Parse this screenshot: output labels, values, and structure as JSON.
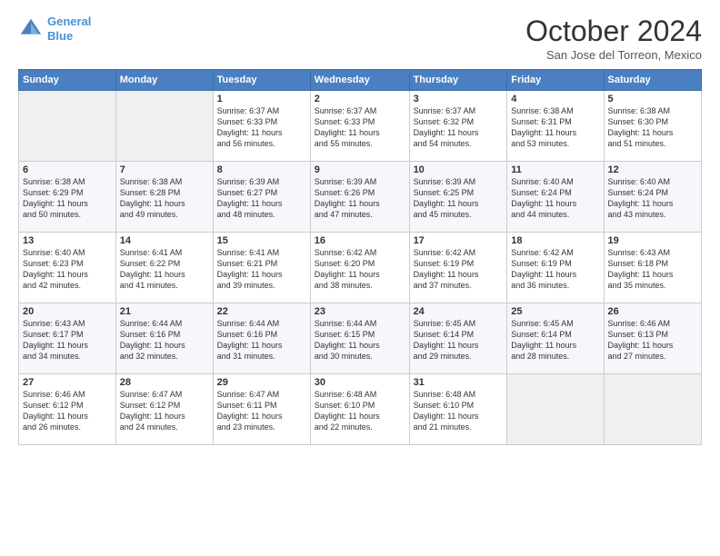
{
  "logo": {
    "line1": "General",
    "line2": "Blue"
  },
  "title": "October 2024",
  "location": "San Jose del Torreon, Mexico",
  "weekdays": [
    "Sunday",
    "Monday",
    "Tuesday",
    "Wednesday",
    "Thursday",
    "Friday",
    "Saturday"
  ],
  "weeks": [
    [
      {
        "day": "",
        "info": ""
      },
      {
        "day": "",
        "info": ""
      },
      {
        "day": "1",
        "info": "Sunrise: 6:37 AM\nSunset: 6:33 PM\nDaylight: 11 hours\nand 56 minutes."
      },
      {
        "day": "2",
        "info": "Sunrise: 6:37 AM\nSunset: 6:33 PM\nDaylight: 11 hours\nand 55 minutes."
      },
      {
        "day": "3",
        "info": "Sunrise: 6:37 AM\nSunset: 6:32 PM\nDaylight: 11 hours\nand 54 minutes."
      },
      {
        "day": "4",
        "info": "Sunrise: 6:38 AM\nSunset: 6:31 PM\nDaylight: 11 hours\nand 53 minutes."
      },
      {
        "day": "5",
        "info": "Sunrise: 6:38 AM\nSunset: 6:30 PM\nDaylight: 11 hours\nand 51 minutes."
      }
    ],
    [
      {
        "day": "6",
        "info": "Sunrise: 6:38 AM\nSunset: 6:29 PM\nDaylight: 11 hours\nand 50 minutes."
      },
      {
        "day": "7",
        "info": "Sunrise: 6:38 AM\nSunset: 6:28 PM\nDaylight: 11 hours\nand 49 minutes."
      },
      {
        "day": "8",
        "info": "Sunrise: 6:39 AM\nSunset: 6:27 PM\nDaylight: 11 hours\nand 48 minutes."
      },
      {
        "day": "9",
        "info": "Sunrise: 6:39 AM\nSunset: 6:26 PM\nDaylight: 11 hours\nand 47 minutes."
      },
      {
        "day": "10",
        "info": "Sunrise: 6:39 AM\nSunset: 6:25 PM\nDaylight: 11 hours\nand 45 minutes."
      },
      {
        "day": "11",
        "info": "Sunrise: 6:40 AM\nSunset: 6:24 PM\nDaylight: 11 hours\nand 44 minutes."
      },
      {
        "day": "12",
        "info": "Sunrise: 6:40 AM\nSunset: 6:24 PM\nDaylight: 11 hours\nand 43 minutes."
      }
    ],
    [
      {
        "day": "13",
        "info": "Sunrise: 6:40 AM\nSunset: 6:23 PM\nDaylight: 11 hours\nand 42 minutes."
      },
      {
        "day": "14",
        "info": "Sunrise: 6:41 AM\nSunset: 6:22 PM\nDaylight: 11 hours\nand 41 minutes."
      },
      {
        "day": "15",
        "info": "Sunrise: 6:41 AM\nSunset: 6:21 PM\nDaylight: 11 hours\nand 39 minutes."
      },
      {
        "day": "16",
        "info": "Sunrise: 6:42 AM\nSunset: 6:20 PM\nDaylight: 11 hours\nand 38 minutes."
      },
      {
        "day": "17",
        "info": "Sunrise: 6:42 AM\nSunset: 6:19 PM\nDaylight: 11 hours\nand 37 minutes."
      },
      {
        "day": "18",
        "info": "Sunrise: 6:42 AM\nSunset: 6:19 PM\nDaylight: 11 hours\nand 36 minutes."
      },
      {
        "day": "19",
        "info": "Sunrise: 6:43 AM\nSunset: 6:18 PM\nDaylight: 11 hours\nand 35 minutes."
      }
    ],
    [
      {
        "day": "20",
        "info": "Sunrise: 6:43 AM\nSunset: 6:17 PM\nDaylight: 11 hours\nand 34 minutes."
      },
      {
        "day": "21",
        "info": "Sunrise: 6:44 AM\nSunset: 6:16 PM\nDaylight: 11 hours\nand 32 minutes."
      },
      {
        "day": "22",
        "info": "Sunrise: 6:44 AM\nSunset: 6:16 PM\nDaylight: 11 hours\nand 31 minutes."
      },
      {
        "day": "23",
        "info": "Sunrise: 6:44 AM\nSunset: 6:15 PM\nDaylight: 11 hours\nand 30 minutes."
      },
      {
        "day": "24",
        "info": "Sunrise: 6:45 AM\nSunset: 6:14 PM\nDaylight: 11 hours\nand 29 minutes."
      },
      {
        "day": "25",
        "info": "Sunrise: 6:45 AM\nSunset: 6:14 PM\nDaylight: 11 hours\nand 28 minutes."
      },
      {
        "day": "26",
        "info": "Sunrise: 6:46 AM\nSunset: 6:13 PM\nDaylight: 11 hours\nand 27 minutes."
      }
    ],
    [
      {
        "day": "27",
        "info": "Sunrise: 6:46 AM\nSunset: 6:12 PM\nDaylight: 11 hours\nand 26 minutes."
      },
      {
        "day": "28",
        "info": "Sunrise: 6:47 AM\nSunset: 6:12 PM\nDaylight: 11 hours\nand 24 minutes."
      },
      {
        "day": "29",
        "info": "Sunrise: 6:47 AM\nSunset: 6:11 PM\nDaylight: 11 hours\nand 23 minutes."
      },
      {
        "day": "30",
        "info": "Sunrise: 6:48 AM\nSunset: 6:10 PM\nDaylight: 11 hours\nand 22 minutes."
      },
      {
        "day": "31",
        "info": "Sunrise: 6:48 AM\nSunset: 6:10 PM\nDaylight: 11 hours\nand 21 minutes."
      },
      {
        "day": "",
        "info": ""
      },
      {
        "day": "",
        "info": ""
      }
    ]
  ]
}
